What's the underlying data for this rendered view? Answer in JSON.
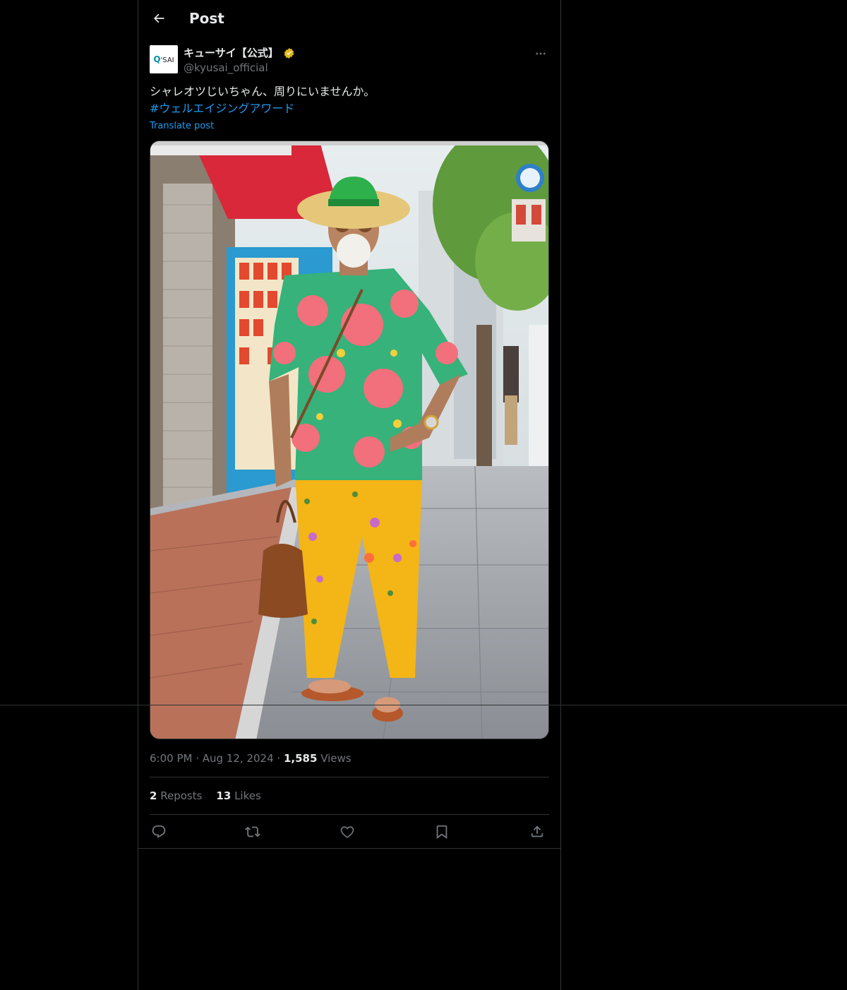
{
  "header": {
    "title": "Post"
  },
  "author": {
    "display_name": "キューサイ【公式】",
    "handle": "@kyusai_official",
    "avatar_text": "Q'SAI"
  },
  "post": {
    "text": "シャレオツじいちゃん、周りにいませんか。",
    "hashtag": "#ウェルエイジングアワード",
    "translate_label": "Translate post",
    "time": "6:00 PM",
    "date": "Aug 12, 2024",
    "views_count": "1,585",
    "views_label": "Views",
    "reposts_count": "2",
    "reposts_label": "Reposts",
    "likes_count": "13",
    "likes_label": "Likes"
  },
  "icons": {
    "back": "arrow-left-icon",
    "more": "more-horizontal-icon",
    "verified": "verified-badge-icon",
    "reply": "reply-icon",
    "repost": "repost-icon",
    "like": "heart-icon",
    "bookmark": "bookmark-icon",
    "share": "share-icon"
  },
  "colors": {
    "background": "#000000",
    "text": "#e7e9ea",
    "secondary": "#71767b",
    "accent": "#1d9bf0",
    "border": "#2f3336",
    "verified_gold": "#e2b719"
  }
}
